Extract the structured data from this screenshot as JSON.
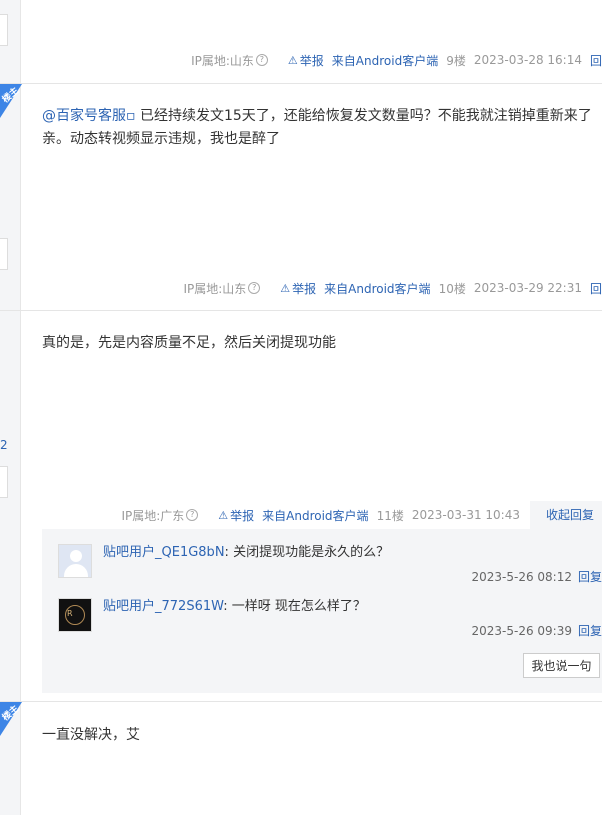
{
  "posts": [
    {
      "floor": "9楼",
      "ip": "IP属地:山东",
      "report": "举报",
      "client": "来自Android客户端",
      "time": "2023-03-28 16:14",
      "reply": "回"
    },
    {
      "badge": "楼主",
      "mention": "@百家号客服",
      "text": "已经持续发文15天了，还能给恢复发文数量吗？不能我就注销掉重新来了亲。动态转视频显示违规，我也是醉了",
      "floor": "10楼",
      "ip": "IP属地:山东",
      "report": "举报",
      "client": "来自Android客户端",
      "time": "2023-03-29 22:31",
      "reply": "回"
    },
    {
      "text": "真的是，先是内容质量不足，然后关闭提现功能",
      "floor": "11楼",
      "ip": "IP属地:广东",
      "report": "举报",
      "client": "来自Android客户端",
      "time": "2023-03-31 10:43",
      "collapse": "收起回复",
      "left_number": "2",
      "replies": [
        {
          "user": "贴吧用户_QE1G8bN",
          "text": "关闭提现功能是永久的么？",
          "time": "2023-5-26 08:12",
          "reply": "回复"
        },
        {
          "user": "贴吧用户_772S61W",
          "text": "一样呀 现在怎么样了？",
          "time": "2023-5-26 09:39",
          "reply": "回复"
        }
      ],
      "say_button": "我也说一句"
    },
    {
      "badge": "楼主",
      "text": "一直没解决，艾"
    }
  ],
  "colors": {
    "link": "#2d64b3",
    "badge": "#3d85e6",
    "muted": "#999999"
  }
}
